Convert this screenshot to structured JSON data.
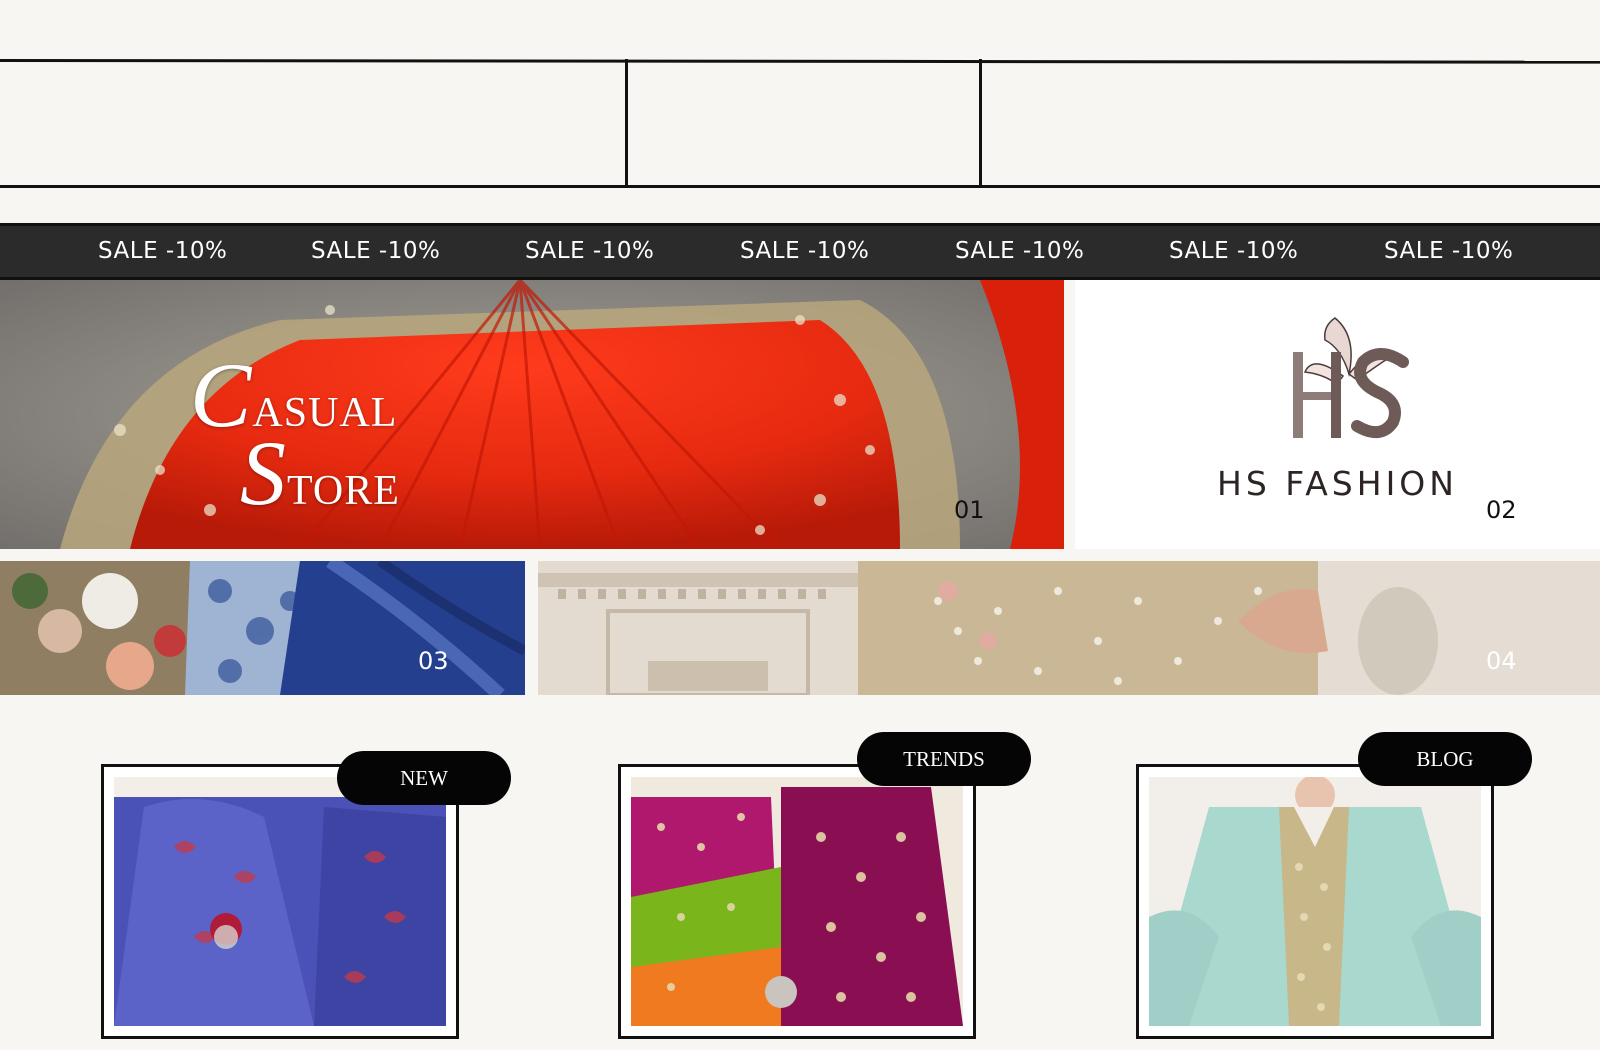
{
  "sale_bar": {
    "items": [
      "SALE -10%",
      "SALE -10%",
      "SALE -10%",
      "SALE -10%",
      "SALE -10%",
      "SALE -10%",
      "SALE -10%"
    ]
  },
  "hero": {
    "tile1": {
      "title_line1_cap": "C",
      "title_line1_rest": "ASUAL",
      "title_line2_cap": "S",
      "title_line2_rest": "TORE",
      "number": "01"
    },
    "tile2": {
      "logo_letters": "HS",
      "brand_name": "HS FASHION",
      "number": "02"
    },
    "tile3": {
      "number": "03"
    },
    "tile4": {
      "number": "04"
    }
  },
  "cards": [
    {
      "tag": "NEW"
    },
    {
      "tag": "TRENDS"
    },
    {
      "tag": "BLOG"
    }
  ],
  "colors": {
    "background": "#f7f6f2",
    "sale_bar": "#2b2b2b",
    "tag": "#050505",
    "brand_text": "#2c2524"
  },
  "icons": {
    "logo": "lily-flower-monogram-icon"
  }
}
